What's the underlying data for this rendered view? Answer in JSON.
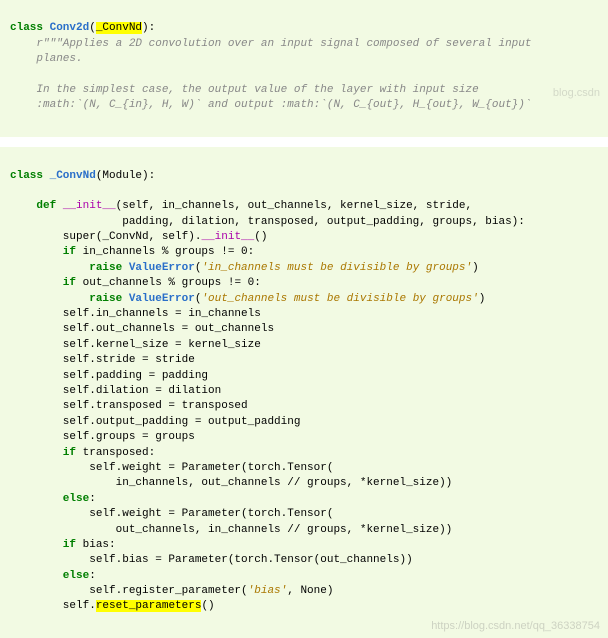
{
  "block1": {
    "l1a": "class ",
    "l1b": "Conv2d",
    "l1c": "(",
    "l1d": "_ConvNd",
    "l1e": "):",
    "l2": "    r\"\"\"Applies a 2D convolution over an input signal composed of several input",
    "l3": "    planes.",
    "l4": "",
    "l5": "    In the simplest case, the output value of the layer with input size",
    "l6": "    :math:`(N, C_{in}, H, W)` and output :math:`(N, C_{out}, H_{out}, W_{out})`",
    "wm": "blog.csdn"
  },
  "block2": {
    "l1a": "class ",
    "l1b": "_ConvNd",
    "l1c": "(Module):",
    "l2": "",
    "l3a": "    def ",
    "l3b": "__init__",
    "l3c": "(self, in_channels, out_channels, kernel_size, stride,",
    "l4": "                 padding, dilation, transposed, output_padding, groups, bias):",
    "l5a": "        super(_ConvNd, self).",
    "l5b": "__init__",
    "l5c": "()",
    "l6a": "        if",
    "l6b": " in_channels % groups != 0:",
    "l7a": "            raise ",
    "l7b": "ValueError",
    "l7c": "(",
    "l7d": "'in_channels must be divisible by groups'",
    "l7e": ")",
    "l8a": "        if",
    "l8b": " out_channels % groups != 0:",
    "l9a": "            raise ",
    "l9b": "ValueError",
    "l9c": "(",
    "l9d": "'out_channels must be divisible by groups'",
    "l9e": ")",
    "l10": "        self.in_channels = in_channels",
    "l11": "        self.out_channels = out_channels",
    "l12": "        self.kernel_size = kernel_size",
    "l13": "        self.stride = stride",
    "l14": "        self.padding = padding",
    "l15": "        self.dilation = dilation",
    "l16": "        self.transposed = transposed",
    "l17": "        self.output_padding = output_padding",
    "l18": "        self.groups = groups",
    "l19a": "        if",
    "l19b": " transposed:",
    "l20": "            self.weight = Parameter(torch.Tensor(",
    "l21": "                in_channels, out_channels // groups, *kernel_size))",
    "l22a": "        else",
    "l22b": ":",
    "l23": "            self.weight = Parameter(torch.Tensor(",
    "l24": "                out_channels, in_channels // groups, *kernel_size))",
    "l25a": "        if",
    "l25b": " bias:",
    "l26": "            self.bias = Parameter(torch.Tensor(out_channels))",
    "l27a": "        else",
    "l27b": ":",
    "l28a": "            self.register_parameter(",
    "l28b": "'bias'",
    "l28c": ", None)",
    "l29a": "        self.",
    "l29b": "reset_parameters",
    "l29c": "()",
    "wm": "https://blog.csdn.net/qq_36338754"
  }
}
